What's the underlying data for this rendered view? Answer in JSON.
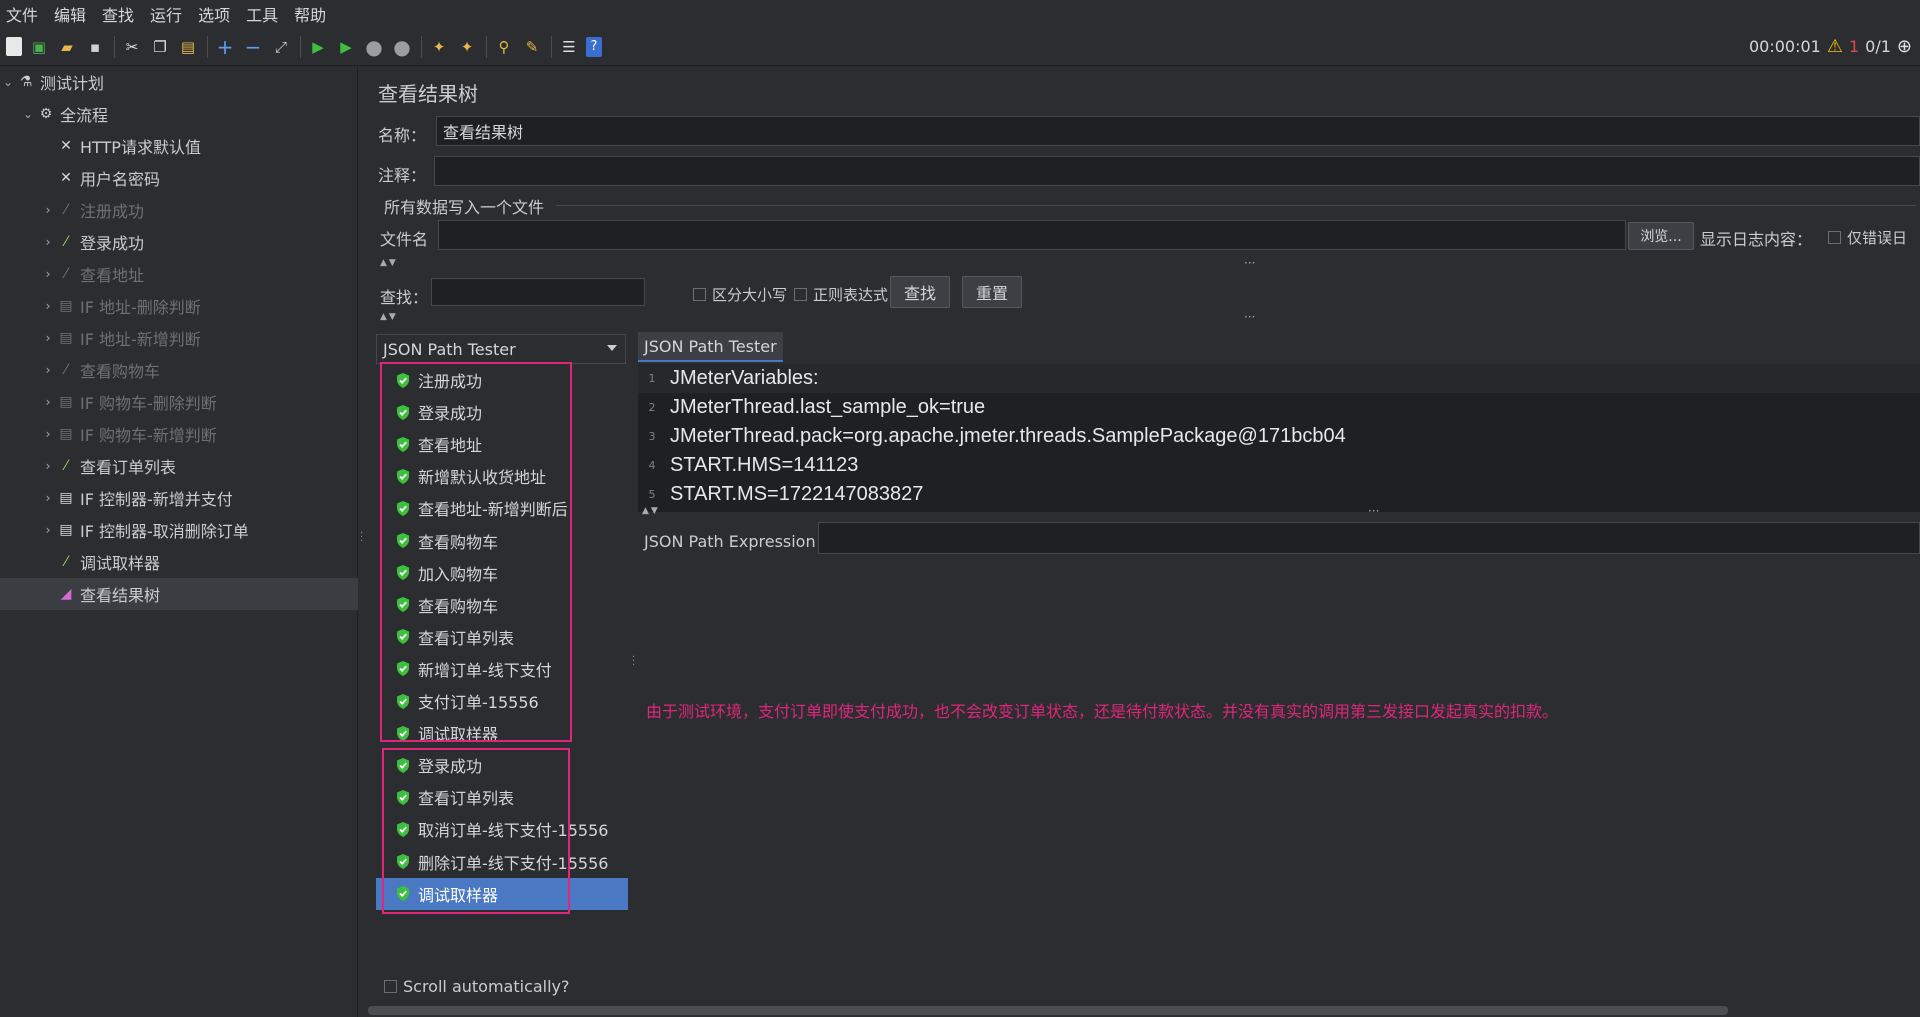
{
  "menu": [
    "文件",
    "编辑",
    "查找",
    "运行",
    "选项",
    "工具",
    "帮助"
  ],
  "status": {
    "time": "00:00:01",
    "warnings": "1",
    "threads": "0/1"
  },
  "tree": {
    "items": [
      {
        "label": "测试计划",
        "icon": "flask-icon",
        "dim": false
      },
      {
        "label": "全流程",
        "icon": "gear-icon",
        "dim": false
      },
      {
        "label": "HTTP请求默认值",
        "icon": "tools-icon",
        "dim": false
      },
      {
        "label": "用户名密码",
        "icon": "tools-icon",
        "dim": false
      },
      {
        "label": "注册成功",
        "icon": "pipette-icon",
        "dim": true
      },
      {
        "label": "登录成功",
        "icon": "pipette-icon",
        "dim": false
      },
      {
        "label": "查看地址",
        "icon": "pipette-icon",
        "dim": true
      },
      {
        "label": "IF 地址-删除判断",
        "icon": "if-icon",
        "dim": true
      },
      {
        "label": "IF 地址-新增判断",
        "icon": "if-icon",
        "dim": true
      },
      {
        "label": "查看购物车",
        "icon": "pipette-icon",
        "dim": true
      },
      {
        "label": "IF 购物车-删除判断",
        "icon": "if-icon",
        "dim": true
      },
      {
        "label": "IF 购物车-新增判断",
        "icon": "if-icon",
        "dim": true
      },
      {
        "label": "查看订单列表",
        "icon": "pipette-icon",
        "dim": false
      },
      {
        "label": "IF 控制器-新增并支付",
        "icon": "if-icon",
        "dim": false
      },
      {
        "label": "IF 控制器-取消删除订单",
        "icon": "if-icon",
        "dim": false
      },
      {
        "label": "调试取样器",
        "icon": "pipette-icon",
        "dim": false
      },
      {
        "label": "查看结果树",
        "icon": "chart-icon",
        "dim": false
      }
    ]
  },
  "main": {
    "title": "查看结果树",
    "name_label": "名称：",
    "name_value": "查看结果树",
    "comment_label": "注释：",
    "group_title": "所有数据写入一个文件",
    "file_label": "文件名",
    "browse_label": "浏览...",
    "log_label": "显示日志内容：",
    "errors_only_label": "仅错误日",
    "search_label": "查找：",
    "case_label": "区分大小写",
    "regex_label": "正则表达式",
    "find_btn": "查找",
    "reset_btn": "重置"
  },
  "results": {
    "renderer": "JSON Path Tester",
    "items": [
      "注册成功",
      "登录成功",
      "查看地址",
      "新增默认收货地址",
      "查看地址-新增判断后",
      "查看购物车",
      "加入购物车",
      "查看购物车",
      "查看订单列表",
      "新增订单-线下支付",
      "支付订单-15556",
      "调试取样器",
      "登录成功",
      "查看订单列表",
      "取消订单-线下支付-15556",
      "删除订单-线下支付-15556",
      "调试取样器"
    ],
    "scroll_auto": "Scroll automatically?"
  },
  "detail": {
    "tab": "JSON Path Tester",
    "lines": [
      "JMeterVariables:",
      "JMeterThread.last_sample_ok=true",
      "JMeterThread.pack=org.apache.jmeter.threads.SamplePackage@171bcb04",
      "START.HMS=141123",
      "START.MS=1722147083827"
    ],
    "expr_label": "JSON Path Expression",
    "note": "由于测试环境，支付订单即使支付成功，也不会改变订单状态，还是待付款状态。并没有真实的调用第三发接口发起真实的扣款。"
  },
  "colors": {
    "accent": "#4a78c2",
    "annotation": "#e0267a",
    "success": "#3fbf3f"
  }
}
